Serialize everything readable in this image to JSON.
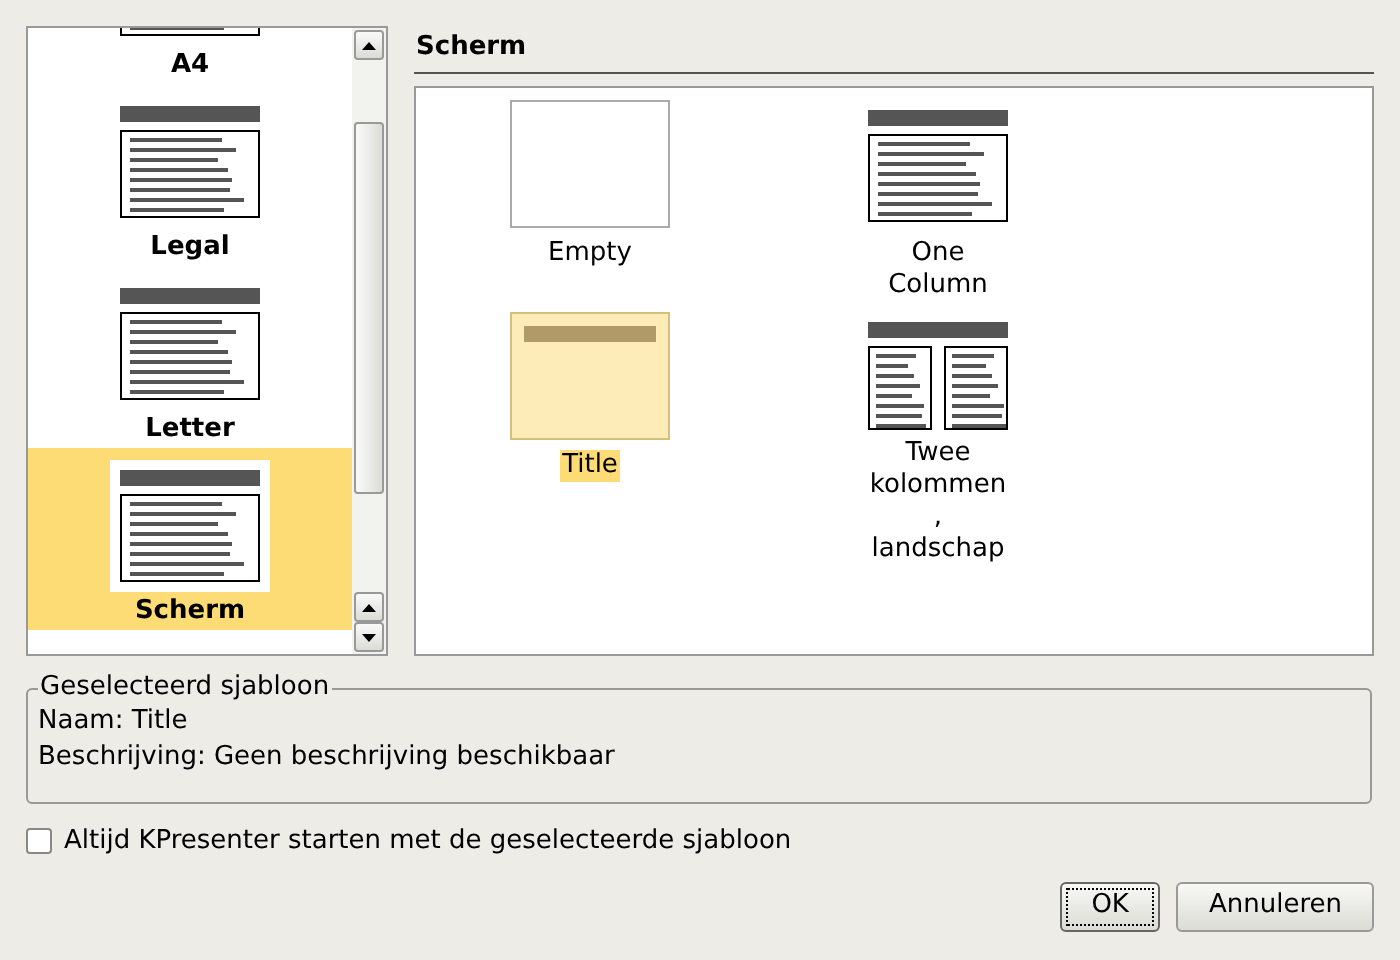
{
  "template_list": {
    "items": [
      {
        "label": "A4",
        "selected": false
      },
      {
        "label": "Legal",
        "selected": false
      },
      {
        "label": "Letter",
        "selected": false
      },
      {
        "label": "Scherm",
        "selected": true
      }
    ]
  },
  "header": {
    "title": "Scherm"
  },
  "templates": [
    {
      "lines": [
        "Empty"
      ],
      "kind": "blank",
      "selected": false
    },
    {
      "lines": [
        "One",
        "Column"
      ],
      "kind": "one-column",
      "selected": false
    },
    {
      "lines": [
        "Title"
      ],
      "kind": "title",
      "selected": true
    },
    {
      "lines": [
        "Twee",
        "kolommen",
        ",",
        "landschap"
      ],
      "kind": "two-column",
      "selected": false
    }
  ],
  "selected_template": {
    "title": "Geselecteerd sjabloon",
    "lines": [
      "Naam: Title",
      "Beschrijving: Geen beschrijving beschikbaar"
    ]
  },
  "startup_checkbox": {
    "label": "Altijd KPresenter starten met de geselecteerde sjabloon",
    "checked": false
  },
  "buttons": [
    {
      "label": "OK",
      "default": true
    },
    {
      "label": "Annuleren",
      "default": false
    }
  ]
}
